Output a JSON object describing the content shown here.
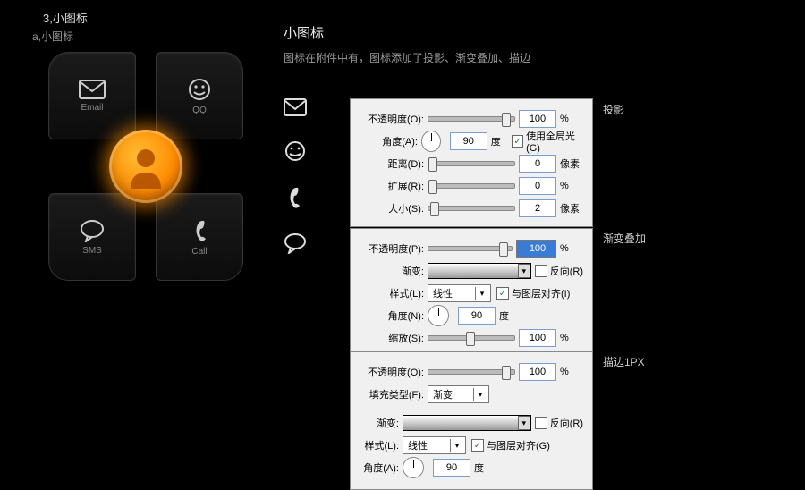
{
  "header": "3,小图标",
  "subheader": "a,小图标",
  "tiles": {
    "email": "Email",
    "qq": "QQ",
    "sms": "SMS",
    "call": "Call"
  },
  "title": "小图标",
  "desc": "图标在附件中有，图标添加了投影、渐变叠加、描边",
  "tags": {
    "shadow": "投影",
    "overlay": "渐变叠加",
    "stroke": "描边1PX"
  },
  "shadow": {
    "opacity_l": "不透明度(O):",
    "opacity_v": "100",
    "opacity_u": "%",
    "angle_l": "角度(A):",
    "angle_v": "90",
    "angle_u": "度",
    "global": "使用全局光(G)",
    "dist_l": "距离(D):",
    "dist_v": "0",
    "dist_u": "像素",
    "spread_l": "扩展(R):",
    "spread_v": "0",
    "spread_u": "%",
    "size_l": "大小(S):",
    "size_v": "2",
    "size_u": "像素"
  },
  "overlay": {
    "opacity_l": "不透明度(P):",
    "opacity_v": "100",
    "opacity_u": "%",
    "grad_l": "渐变:",
    "reverse": "反向(R)",
    "style_l": "样式(L):",
    "style_v": "线性",
    "align": "与图层对齐(I)",
    "angle_l": "角度(N):",
    "angle_v": "90",
    "angle_u": "度",
    "scale_l": "缩放(S):",
    "scale_v": "100",
    "scale_u": "%"
  },
  "stroke": {
    "opacity_l": "不透明度(O):",
    "opacity_v": "100",
    "opacity_u": "%",
    "fill_l": "填充类型(F):",
    "fill_v": "渐变",
    "grad_l": "渐变:",
    "reverse": "反向(R)",
    "style_l": "样式(L):",
    "style_v": "线性",
    "align": "与图层对齐(G)",
    "angle_l": "角度(A):",
    "angle_v": "90",
    "angle_u": "度"
  }
}
